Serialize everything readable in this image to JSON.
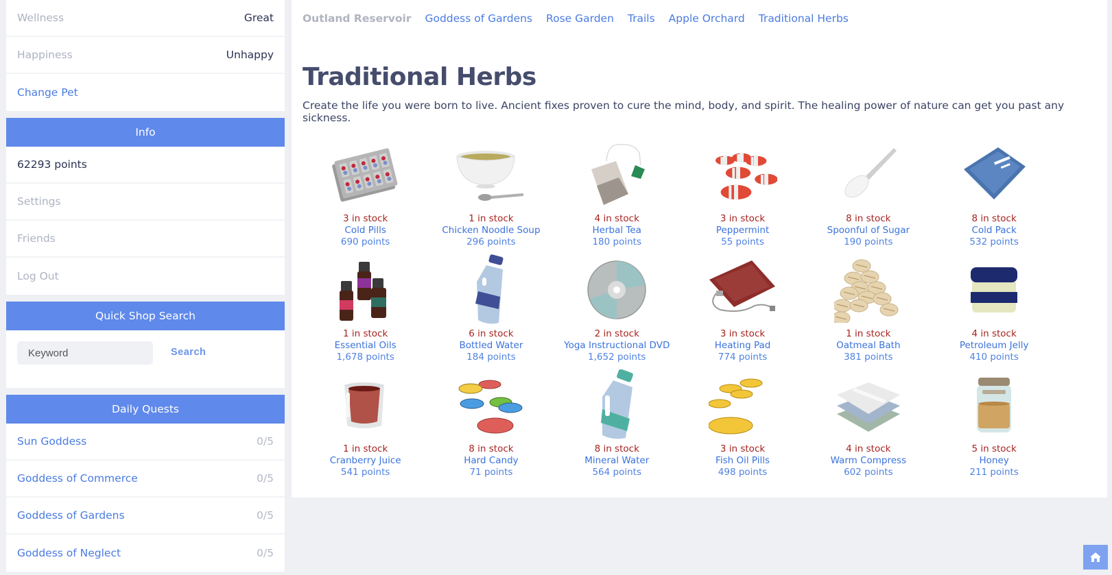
{
  "sidebar": {
    "pet": {
      "wellness_label": "Wellness",
      "wellness_value": "Great",
      "happiness_label": "Happiness",
      "happiness_value": "Unhappy",
      "change_pet": "Change Pet"
    },
    "info": {
      "header": "Info",
      "points": "62293 points",
      "settings": "Settings",
      "friends": "Friends",
      "logout": "Log Out"
    },
    "quick_search": {
      "header": "Quick Shop Search",
      "placeholder": "Keyword",
      "button": "Search"
    },
    "daily_quests": {
      "header": "Daily Quests",
      "items": [
        {
          "name": "Sun Goddess",
          "progress": "0/5"
        },
        {
          "name": "Goddess of Commerce",
          "progress": "0/5"
        },
        {
          "name": "Goddess of Gardens",
          "progress": "0/5"
        },
        {
          "name": "Goddess of Neglect",
          "progress": "0/5"
        }
      ]
    }
  },
  "breadcrumbs": [
    "Outland Reservoir",
    "Goddess of Gardens",
    "Rose Garden",
    "Trails",
    "Apple Orchard",
    "Traditional Herbs"
  ],
  "page": {
    "title": "Traditional Herbs",
    "description": "Create the life you were born to live. Ancient fixes proven to cure the mind, body, and spirit. The healing power of nature can get you past any sickness."
  },
  "items": [
    {
      "stock": "3 in stock",
      "name": "Cold Pills",
      "points": "690 points",
      "icon": "pills-blister-icon"
    },
    {
      "stock": "1 in stock",
      "name": "Chicken Noodle Soup",
      "points": "296 points",
      "icon": "soup-bowl-icon"
    },
    {
      "stock": "4 in stock",
      "name": "Herbal Tea",
      "points": "180 points",
      "icon": "tea-bag-icon"
    },
    {
      "stock": "3 in stock",
      "name": "Peppermint",
      "points": "55 points",
      "icon": "peppermint-candy-icon"
    },
    {
      "stock": "8 in stock",
      "name": "Spoonful of Sugar",
      "points": "190 points",
      "icon": "sugar-spoon-icon"
    },
    {
      "stock": "8 in stock",
      "name": "Cold Pack",
      "points": "532 points",
      "icon": "cold-pack-icon"
    },
    {
      "stock": "1 in stock",
      "name": "Essential Oils",
      "points": "1,678 points",
      "icon": "oil-bottles-icon"
    },
    {
      "stock": "6 in stock",
      "name": "Bottled Water",
      "points": "184 points",
      "icon": "water-bottle-icon"
    },
    {
      "stock": "2 in stock",
      "name": "Yoga Instructional DVD",
      "points": "1,652 points",
      "icon": "dvd-icon"
    },
    {
      "stock": "3 in stock",
      "name": "Heating Pad",
      "points": "774 points",
      "icon": "heating-pad-icon"
    },
    {
      "stock": "1 in stock",
      "name": "Oatmeal Bath",
      "points": "381 points",
      "icon": "oats-icon"
    },
    {
      "stock": "4 in stock",
      "name": "Petroleum Jelly",
      "points": "410 points",
      "icon": "jelly-jar-icon"
    },
    {
      "stock": "1 in stock",
      "name": "Cranberry Juice",
      "points": "541 points",
      "icon": "juice-cup-icon"
    },
    {
      "stock": "8 in stock",
      "name": "Hard Candy",
      "points": "71 points",
      "icon": "hard-candy-icon"
    },
    {
      "stock": "8 in stock",
      "name": "Mineral Water",
      "points": "564 points",
      "icon": "mineral-water-icon"
    },
    {
      "stock": "3 in stock",
      "name": "Fish Oil Pills",
      "points": "498 points",
      "icon": "fish-oil-icon"
    },
    {
      "stock": "4 in stock",
      "name": "Warm Compress",
      "points": "602 points",
      "icon": "towels-icon"
    },
    {
      "stock": "5 in stock",
      "name": "Honey",
      "points": "211 points",
      "icon": "honey-jar-icon"
    }
  ],
  "colors": {
    "accent": "#5f89ea",
    "stock": "#a5231f",
    "link": "#3a72dc"
  }
}
